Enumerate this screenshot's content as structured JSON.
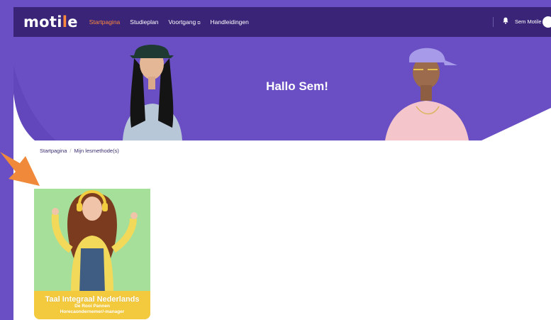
{
  "nav": {
    "logo_main": "moti",
    "logo_accent": "l",
    "logo_tail": "e",
    "links": [
      {
        "label": "Startpagina",
        "active": true
      },
      {
        "label": "Studieplan",
        "active": false
      },
      {
        "label": "Voortgang",
        "external": true
      },
      {
        "label": "Handleidingen",
        "active": false
      }
    ],
    "external_icon": "external-link-icon",
    "bell_icon": "bell-icon",
    "user_name": "Sem Motile"
  },
  "hero": {
    "greeting": "Hallo Sem!"
  },
  "breadcrumb": {
    "home": "Startpagina",
    "separator": "/",
    "current": "Mijn lesmethode(s)"
  },
  "course": {
    "title": "Taal Integraal Nederlands",
    "subtitle_1": "De Rooi Pannen",
    "subtitle_2": "Horecaondernemer/-manager"
  },
  "colors": {
    "nav_bg": "#3a2478",
    "accent": "#ff8a3d",
    "hero_bg": "#6a4fc4",
    "card_footer": "#f3c93d",
    "card_bg": "#a6df9a",
    "arrow": "#f08a3a"
  }
}
